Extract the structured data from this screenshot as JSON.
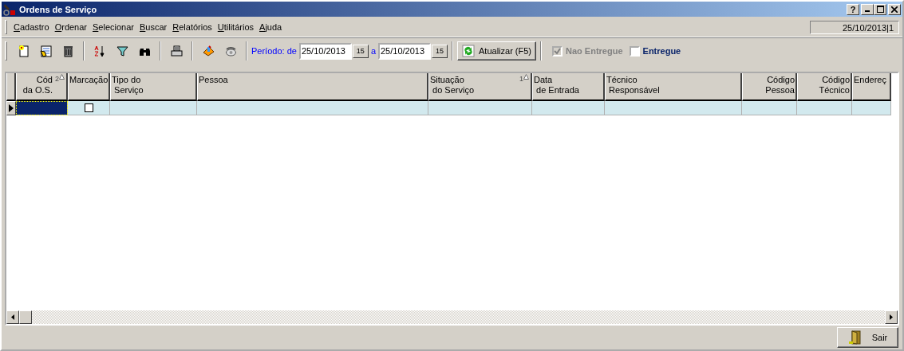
{
  "window": {
    "title": "Ordens de Serviço",
    "help_button": "?"
  },
  "menu": {
    "items": [
      "Cadastro",
      "Ordenar",
      "Selecionar",
      "Buscar",
      "Relatórios",
      "Utilitários",
      "Ajuda"
    ],
    "status": "25/10/2013|1"
  },
  "period": {
    "label": "Período: de",
    "from": "25/10/2013",
    "from_calendar": "15",
    "separator": "a",
    "to": "25/10/2013",
    "to_calendar": "15"
  },
  "refresh_button": "Atualizar (F5)",
  "filters": [
    {
      "label": "Nao Entregue",
      "checked": true,
      "disabled": true
    },
    {
      "label": "Entregue",
      "checked": false,
      "disabled": false
    }
  ],
  "table": {
    "columns": [
      {
        "lines": [
          "Cód",
          "da O.S."
        ],
        "sort": "2"
      },
      {
        "lines": [
          "Marcação"
        ]
      },
      {
        "lines": [
          "Tipo do",
          " Serviço"
        ]
      },
      {
        "lines": [
          "Pessoa"
        ]
      },
      {
        "lines": [
          "Situação",
          " do Serviço"
        ],
        "sort": "1"
      },
      {
        "lines": [
          "Data",
          " de Entrada"
        ]
      },
      {
        "lines": [
          "Técnico",
          " Responsável"
        ]
      },
      {
        "lines": [
          "Código",
          "Pessoa"
        ]
      },
      {
        "lines": [
          "Código",
          "Técnico"
        ]
      },
      {
        "lines": [
          "Endereç"
        ]
      }
    ],
    "rows": [
      {
        "selected": true,
        "marked": false
      }
    ]
  },
  "footer": {
    "exit_button": "Sair"
  }
}
